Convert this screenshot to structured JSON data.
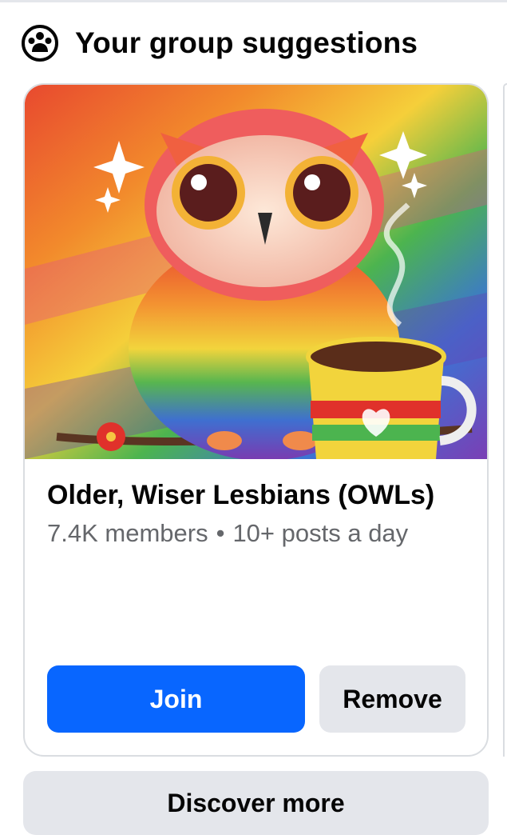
{
  "section": {
    "title": "Your group suggestions",
    "icon": "groups-icon"
  },
  "group_card": {
    "image": "rainbow-owl-with-coffee-cup",
    "name": "Older, Wiser Lesbians (OWLs)",
    "members": "7.4K members",
    "separator": "•",
    "activity": "10+ posts a day",
    "join_label": "Join",
    "remove_label": "Remove"
  },
  "discover": {
    "label": "Discover more"
  },
  "colors": {
    "accent": "#0866ff",
    "secondary_button": "#e4e6eb",
    "meta_text": "#65676b",
    "border": "#dadde1"
  }
}
